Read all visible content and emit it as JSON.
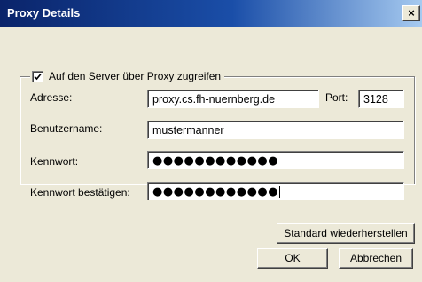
{
  "window": {
    "title": "Proxy Details",
    "close_glyph": "×"
  },
  "group": {
    "checkbox_checked": true,
    "checkbox_label": "Auf den Server über Proxy zugreifen"
  },
  "fields": {
    "address_label": "Adresse:",
    "address_value": "proxy.cs.fh-nuernberg.de",
    "port_label": "Port:",
    "port_value": "3128",
    "username_label": "Benutzername:",
    "username_value": "mustermanner",
    "password_label": "Kennwort:",
    "password_value": "●●●●●●●●●●●●",
    "confirm_label": "Kennwort bestätigen:",
    "confirm_value": "●●●●●●●●●●●●"
  },
  "buttons": {
    "restore": "Standard wiederherstellen",
    "ok": "OK",
    "cancel": "Abbrechen"
  }
}
